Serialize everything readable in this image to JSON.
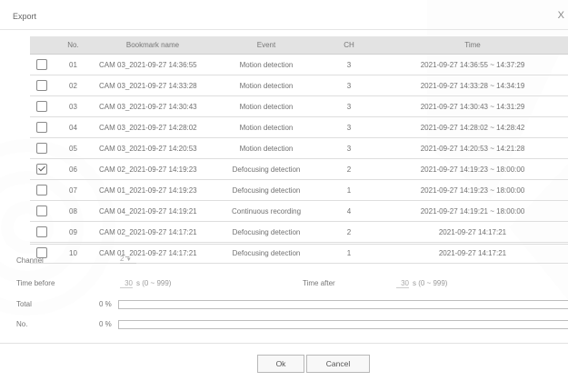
{
  "dialog": {
    "title": "Export",
    "close_glyph": "X"
  },
  "table": {
    "headers": {
      "no": "No.",
      "name": "Bookmark name",
      "event": "Event",
      "ch": "CH",
      "time": "Time"
    },
    "rows": [
      {
        "checked": false,
        "no": "01",
        "name": "CAM 03_2021-09-27 14:36:55",
        "event": "Motion detection",
        "ch": "3",
        "time": "2021-09-27 14:36:55 ~ 14:37:29"
      },
      {
        "checked": false,
        "no": "02",
        "name": "CAM 03_2021-09-27 14:33:28",
        "event": "Motion detection",
        "ch": "3",
        "time": "2021-09-27 14:33:28 ~ 14:34:19"
      },
      {
        "checked": false,
        "no": "03",
        "name": "CAM 03_2021-09-27 14:30:43",
        "event": "Motion detection",
        "ch": "3",
        "time": "2021-09-27 14:30:43 ~ 14:31:29"
      },
      {
        "checked": false,
        "no": "04",
        "name": "CAM 03_2021-09-27 14:28:02",
        "event": "Motion detection",
        "ch": "3",
        "time": "2021-09-27 14:28:02 ~ 14:28:42"
      },
      {
        "checked": false,
        "no": "05",
        "name": "CAM 03_2021-09-27 14:20:53",
        "event": "Motion detection",
        "ch": "3",
        "time": "2021-09-27 14:20:53 ~ 14:21:28"
      },
      {
        "checked": true,
        "no": "06",
        "name": "CAM 02_2021-09-27 14:19:23",
        "event": "Defocusing detection",
        "ch": "2",
        "time": "2021-09-27 14:19:23 ~ 18:00:00"
      },
      {
        "checked": false,
        "no": "07",
        "name": "CAM 01_2021-09-27 14:19:23",
        "event": "Defocusing detection",
        "ch": "1",
        "time": "2021-09-27 14:19:23 ~ 18:00:00"
      },
      {
        "checked": false,
        "no": "08",
        "name": "CAM 04_2021-09-27 14:19:21",
        "event": "Continuous recording",
        "ch": "4",
        "time": "2021-09-27 14:19:21 ~ 18:00:00"
      },
      {
        "checked": false,
        "no": "09",
        "name": "CAM 02_2021-09-27 14:17:21",
        "event": "Defocusing detection",
        "ch": "2",
        "time": "2021-09-27 14:17:21"
      },
      {
        "checked": false,
        "no": "10",
        "name": "CAM 01_2021-09-27 14:17:21",
        "event": "Defocusing detection",
        "ch": "1",
        "time": "2021-09-27 14:17:21"
      }
    ]
  },
  "options": {
    "channel_label": "Channel",
    "channel_value": "2",
    "time_before_label": "Time before",
    "time_before_value": "30",
    "time_before_unit": "s (0 ~ 999)",
    "time_after_label": "Time after",
    "time_after_value": "30",
    "time_after_unit": "s (0 ~ 999)"
  },
  "progress": {
    "total_label": "Total",
    "total_pct": "0 %",
    "total_fraction": 0,
    "no_label": "No.",
    "no_pct": "0 %",
    "no_fraction": 0
  },
  "buttons": {
    "ok": "Ok",
    "cancel": "Cancel"
  },
  "colors": {
    "header_bg": "#e3e3e3",
    "row_rule": "#dedede",
    "text": "#707070"
  }
}
